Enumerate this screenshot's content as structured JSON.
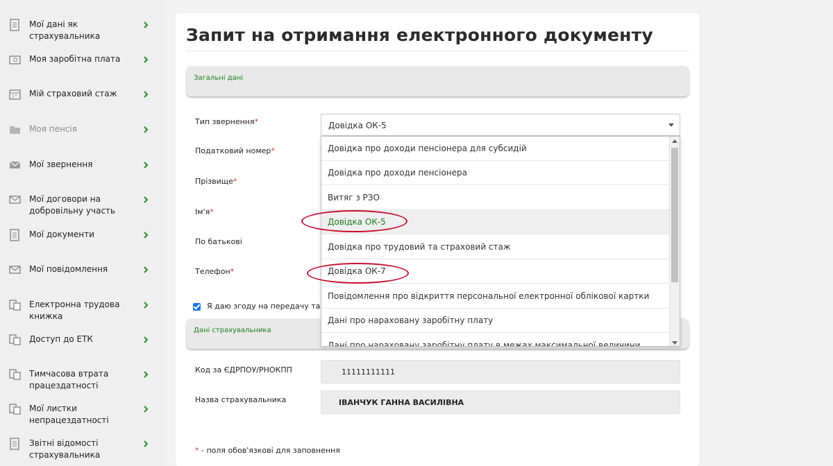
{
  "sidebar": {
    "items": [
      {
        "label": "Мої дані як страхувальника",
        "icon": "document-list-icon"
      },
      {
        "label": "Моя заробітна плата",
        "icon": "wallet-icon"
      },
      {
        "label": "Мій страховий стаж",
        "icon": "calendar-icon"
      },
      {
        "label": "Моя пенсія",
        "icon": "folder-icon",
        "muted": true
      },
      {
        "label": "Мої звернення",
        "icon": "envelope-icon"
      },
      {
        "label": "Мої договори на добровільну участь",
        "icon": "envelope-open-icon"
      },
      {
        "label": "Мої документи",
        "icon": "document-icon"
      },
      {
        "label": "Мої повідомлення",
        "icon": "message-icon"
      },
      {
        "label": "Електронна трудова книжка",
        "icon": "workbook-icon"
      },
      {
        "label": "Доступ до ЕТК",
        "icon": "access-icon"
      },
      {
        "label": "Тимчасова втрата працездатності",
        "icon": "sick-leave-icon"
      },
      {
        "label": "Мої листки непрацездатності",
        "icon": "sheets-icon"
      },
      {
        "label": "Звітні відомості страхувальника",
        "icon": "report-icon"
      }
    ]
  },
  "page": {
    "title": "Запит на отримання електронного документу"
  },
  "sections": {
    "general": "Загальні дані",
    "insurer": "Дані страхувальника"
  },
  "form": {
    "request_type_label": "Тип звернення",
    "tax_number_label": "Податковий номер",
    "surname_label": "Прізвище",
    "name_label": "Ім'я",
    "patronymic_label": "По батькові",
    "phone_label": "Телефон",
    "required_mark": "*",
    "request_type_value": "Довідка ОК-5",
    "consent_text": "Я даю згоду на передачу та об",
    "edrpou_label": "Код за ЄДРПОУ/РНОКПП",
    "edrpou_value": "11111111111",
    "insurer_name_label": "Назва страхувальника",
    "insurer_name_value": "ІВАНЧУК ГАННА ВАСИЛІВНА",
    "footnote_star": "*",
    "footnote_text": " - поля обов'язкові для заповнення"
  },
  "dropdown": {
    "options": [
      "Довідка про доходи пенсіонера для субсидій",
      "Довідка про доходи пенсіонера",
      "Витяг з РЗО",
      "Довідка ОК-5",
      "Довідка про трудовий та страховий стаж",
      "Довідка ОК-7",
      "Повідомлення про відкриття персональної електронної облікової картки",
      "Дані про нараховану заробітну плату",
      "Дані про нараховану заробітну плату в межах максимальної величини"
    ],
    "selected": "Довідка ОК-5",
    "highlighted": [
      "Довідка ОК-5",
      "Довідка ОК-7"
    ]
  },
  "colors": {
    "accent_green": "#1e7b1e",
    "highlight_red": "#c8102e",
    "checkbox_blue": "#1a73e8"
  }
}
